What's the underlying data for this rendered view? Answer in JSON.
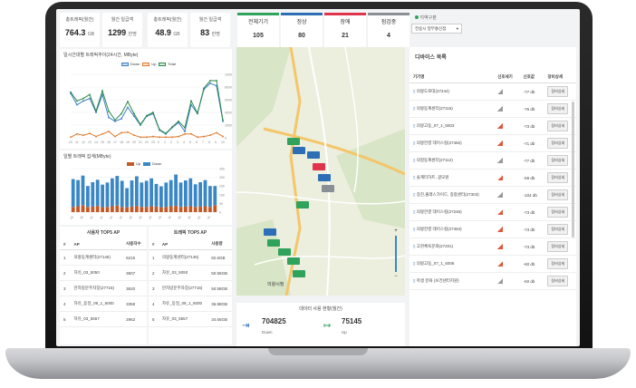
{
  "top_stats": [
    {
      "label": "총트래픽(월간)",
      "value": "764.3",
      "unit": "GB"
    },
    {
      "label": "월간 일급객",
      "value": "1299",
      "unit": "만명"
    },
    {
      "label": "총트래픽(월간)",
      "value": "48.9",
      "unit": "GB"
    },
    {
      "label": "월간 일급객",
      "value": "83",
      "unit": "만명"
    }
  ],
  "status_cards": [
    {
      "label": "전체기기",
      "value": "105",
      "color": "#2fa35b"
    },
    {
      "label": "정상",
      "value": "80",
      "color": "#2d6fb7"
    },
    {
      "label": "장애",
      "value": "21",
      "color": "#e0344b"
    },
    {
      "label": "점검중",
      "value": "4",
      "color": "#8a8f96"
    }
  ],
  "region": {
    "label": "지역구분",
    "selected": "전용시 정부통신점"
  },
  "line_chart": {
    "title": "일시간대별 트래픽추이(24시간, MByte)",
    "legend": [
      "Down",
      "Up",
      "Total"
    ]
  },
  "bar_chart": {
    "title": "일별 트래픽 집계(MByte)",
    "legend": [
      "Up",
      "Down"
    ]
  },
  "chart_data": [
    {
      "type": "line",
      "x": [
        "10",
        "11",
        "12",
        "13",
        "14",
        "15",
        "16",
        "17",
        "18",
        "19",
        "20",
        "21",
        "22",
        "23",
        "0",
        "1",
        "2",
        "3",
        "4",
        "5",
        "6",
        "7",
        "8",
        "9",
        "10"
      ],
      "series": [
        {
          "name": "Down",
          "values": [
            7000,
            5200,
            5800,
            6200,
            4000,
            6800,
            3200,
            2600,
            3000,
            4800,
            3400,
            2000,
            3400,
            3800,
            1200,
            600,
            1600,
            2400,
            1000,
            5200,
            3800,
            7600,
            8600,
            8200,
            2600
          ]
        },
        {
          "name": "Up",
          "values": [
            100,
            600,
            400,
            700,
            200,
            600,
            1000,
            200,
            800,
            900,
            400,
            100,
            100,
            200,
            100,
            100,
            100,
            200,
            600,
            600,
            100,
            200,
            400,
            800,
            200
          ]
        },
        {
          "name": "Total",
          "values": [
            7200,
            5800,
            6200,
            6800,
            4200,
            7400,
            4200,
            2800,
            3800,
            5700,
            3800,
            2100,
            3500,
            4000,
            1300,
            700,
            1700,
            2600,
            1600,
            5800,
            3900,
            7800,
            9000,
            9000,
            2800
          ]
        }
      ],
      "ylim": [
        0,
        10000
      ],
      "yticks": [
        0,
        2000,
        4000,
        6000,
        8000,
        10000
      ]
    },
    {
      "type": "bar",
      "x": [
        "06",
        "07",
        "08",
        "09",
        "10",
        "11",
        "12",
        "13",
        "14",
        "15",
        "16",
        "17",
        "18",
        "19",
        "20",
        "21",
        "22",
        "23",
        "24",
        "25",
        "26",
        "27",
        "28",
        "29",
        "30",
        "01",
        "02",
        "03",
        "04",
        "05"
      ],
      "series": [
        {
          "name": "Up",
          "values": [
            30,
            34,
            40,
            30,
            32,
            36,
            28,
            30,
            34,
            38,
            30,
            28,
            32,
            36,
            30,
            30,
            34,
            32,
            28,
            30,
            34,
            36,
            30,
            32,
            34,
            30,
            32,
            34,
            30,
            40
          ]
        },
        {
          "name": "Down",
          "values": [
            160,
            150,
            170,
            120,
            140,
            150,
            130,
            140,
            160,
            170,
            150,
            110,
            150,
            170,
            140,
            150,
            160,
            130,
            120,
            140,
            150,
            180,
            140,
            150,
            160,
            130,
            140,
            150,
            120,
            110
          ]
        }
      ],
      "ylim": [
        0,
        250
      ],
      "yticks": [
        0,
        50,
        100,
        150,
        200,
        250
      ]
    }
  ],
  "user_ap_table": {
    "title": "사용자 TOP5 AP",
    "headers": [
      "#",
      "AP",
      "사용자수"
    ],
    "rows": [
      [
        "1",
        "의왕동계센터(27146)",
        "6215"
      ],
      [
        "2",
        "자유_03_5050",
        "3607"
      ],
      [
        "3",
        "만자방문주차장(27716)",
        "3620"
      ],
      [
        "4",
        "자유_동일_09_1_6000",
        "3358"
      ],
      [
        "5",
        "자유_03_5557",
        "2962"
      ]
    ]
  },
  "traffic_ap_table": {
    "title": "트래픽 TOP5 AP",
    "headers": [
      "#",
      "AP",
      "사용량"
    ],
    "rows": [
      [
        "1",
        "의왕동계센터(27146)",
        "82.6GB"
      ],
      [
        "2",
        "자유_03_5050",
        "50.56GB"
      ],
      [
        "3",
        "만자방문주차장(27716)",
        "50.58GB"
      ],
      [
        "4",
        "자유_동일_09_1_6000",
        "36.88GB"
      ],
      [
        "5",
        "자유_03_5557",
        "34.65GB"
      ]
    ]
  },
  "traffic_summary": {
    "title": "데이터 사용 현황(월간)",
    "down_value": "704825",
    "down_label": "Down",
    "up_value": "75145",
    "up_label": "Up"
  },
  "device_list": {
    "title": "디바이스 목록",
    "headers": [
      "기기명",
      "신호세기",
      "신호값",
      "장비상세"
    ],
    "button_label": "장비상세",
    "rows": [
      {
        "name": "의왕도로대(27244)",
        "signal": "-77 db",
        "color": "#999999"
      },
      {
        "name": "의왕동계센터(27116)",
        "signal": "-76 db",
        "color": "#999999"
      },
      {
        "name": "의왕고동_07_1_6003",
        "signal": "-73 db",
        "color": "#e0583b"
      },
      {
        "name": "의왕한결 데이스킬(27482)",
        "signal": "-71 db",
        "color": "#e0583b"
      },
      {
        "name": "의정동계센터(27112)",
        "signal": "-77 db",
        "color": "#999999"
      },
      {
        "name": "솔계터하트, 광모원",
        "signal": "-69 db",
        "color": "#e0583b"
      },
      {
        "name": "증진,출래스가이드, 종합센터(27303)",
        "signal": "-104 db",
        "color": "#999999"
      },
      {
        "name": "의왕한결 데이스킬(27246)",
        "signal": "-73 db",
        "color": "#e0583b"
      },
      {
        "name": "의왕한결 데이스킬(27484)",
        "signal": "-73 db",
        "color": "#e0583b"
      },
      {
        "name": "고천체육문화(27201)",
        "signal": "-73 db",
        "color": "#e0583b"
      },
      {
        "name": "의왕고동_07_1_6006",
        "signal": "-60 db",
        "color": "#e0583b"
      },
      {
        "name": "학생 분화 (보건센터지원)",
        "signal": "-60 db",
        "color": "#999999"
      }
    ]
  },
  "map": {
    "label": "의왕시청"
  }
}
